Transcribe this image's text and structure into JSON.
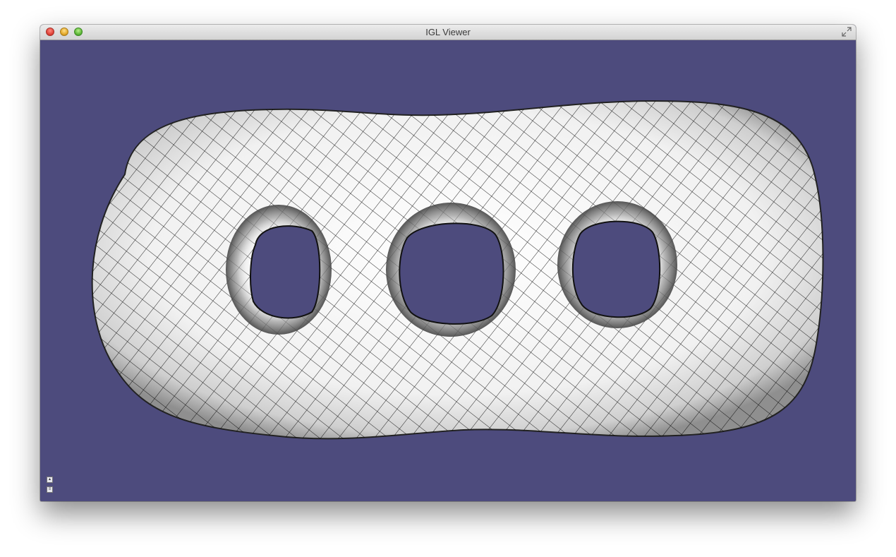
{
  "window": {
    "title": "IGL Viewer",
    "buttons": {
      "close": "close",
      "minimize": "minimize",
      "zoom": "zoom"
    },
    "fullscreen_icon": "fullscreen-icon"
  },
  "viewport": {
    "background_color": "#4d4b7d",
    "mesh": {
      "shape": "triple torus",
      "holes": 3,
      "surface_color": "#ffffff",
      "wireframe_color": "#000000"
    }
  },
  "bottom_controls": [
    {
      "icon": "collapse-icon"
    },
    {
      "icon": "settings-icon"
    }
  ],
  "colors": {
    "background": "#4d4b7d",
    "titlebar": "#dcdcdc"
  }
}
